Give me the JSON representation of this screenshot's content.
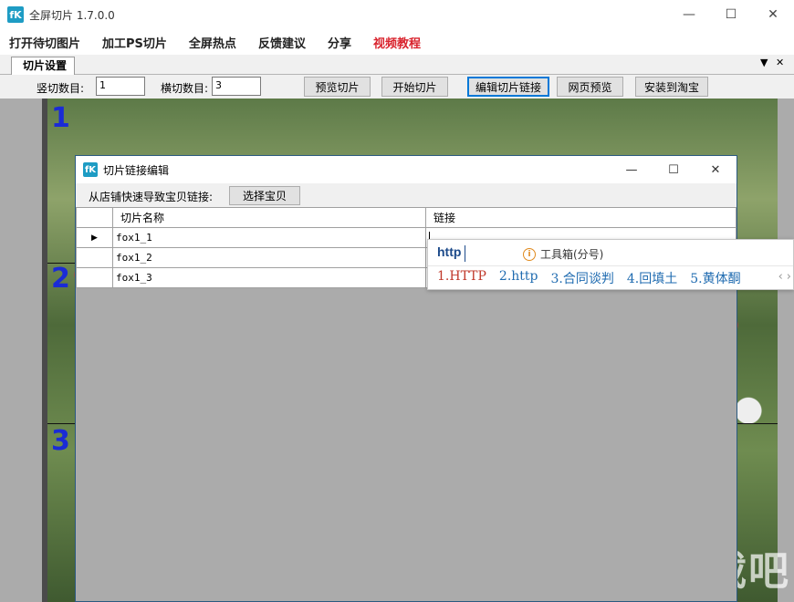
{
  "app": {
    "icon_text": "fK",
    "title": "全屏切片 1.7.0.0"
  },
  "window_controls": {
    "minimize": "—",
    "maximize": "☐",
    "close": "✕"
  },
  "menu": [
    {
      "label": "打开待切图片"
    },
    {
      "label": "加工PS切片"
    },
    {
      "label": "全屏热点"
    },
    {
      "label": "反馈建议"
    },
    {
      "label": "分享"
    },
    {
      "label": "视频教程",
      "color": "#d9232d"
    }
  ],
  "tab": {
    "label": "切片设置",
    "dropdown": "▼",
    "close": "✕"
  },
  "toolbar": {
    "vertical_label": "竖切数目:",
    "vertical_value": "1",
    "horizontal_label": "横切数目:",
    "horizontal_value": "3",
    "preview_slice": "预览切片",
    "start_slice": "开始切片",
    "edit_links": "编辑切片链接",
    "web_preview": "网页预览",
    "install_taobao": "安装到淘宝"
  },
  "canvas": {
    "slice_numbers": [
      "1",
      "2",
      "3"
    ],
    "watermark": "下载吧"
  },
  "dialog": {
    "icon_text": "fK",
    "title": "切片链接编辑",
    "controls": {
      "minimize": "—",
      "maximize": "☐",
      "close": "✕"
    },
    "shop_label": "从店铺快速导致宝贝链接:",
    "select_button": "选择宝贝",
    "columns": [
      "切片名称",
      "链接"
    ],
    "rows": [
      {
        "marker": "▶",
        "name": "fox1_1",
        "link": ""
      },
      {
        "marker": "",
        "name": "fox1_2",
        "link": ""
      },
      {
        "marker": "",
        "name": "fox1_3",
        "link": ""
      }
    ]
  },
  "ime": {
    "input": "http",
    "hint_icon": "i",
    "hint": "工具箱(分号)",
    "candidates": [
      "1.HTTP",
      "2.http",
      "3.合同谈判",
      "4.回填土",
      "5.黄体酮"
    ],
    "nav_prev": "‹",
    "nav_next": "›"
  },
  "colors": {
    "accent": "#0078d7",
    "menu_highlight": "#d9232d",
    "slice_number": "#1a2bd6",
    "ime_candidate": "#1f6bb0",
    "ime_first": "#c0392b"
  }
}
